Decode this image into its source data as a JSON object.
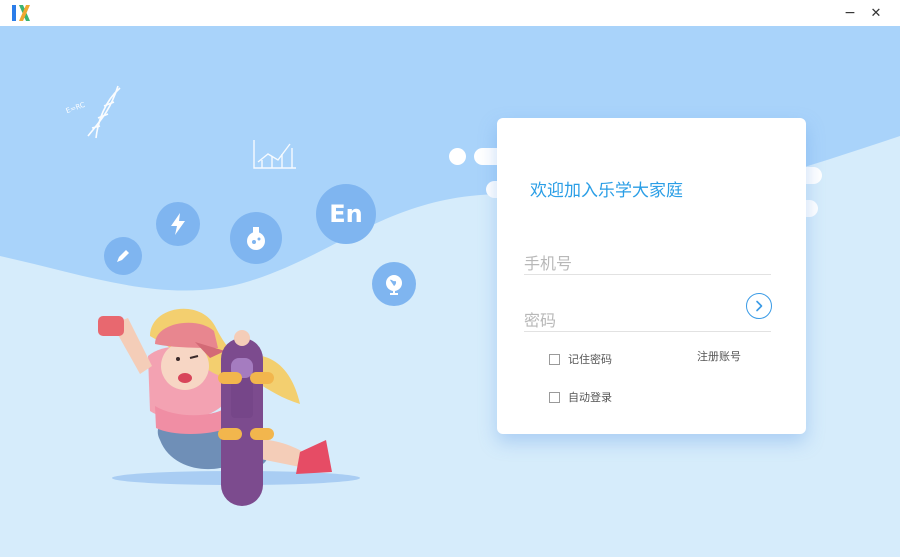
{
  "window": {
    "minimize_glyph": "−",
    "close_glyph": "✕"
  },
  "login": {
    "title": "欢迎加入乐学大家庭",
    "phone_placeholder": "手机号",
    "password_placeholder": "密码",
    "remember_label": "记住密码",
    "auto_login_label": "自动登录",
    "register_label": "注册账号"
  },
  "illustration": {
    "subject_en_label": "En",
    "formula_label": "E=RC"
  },
  "colors": {
    "accent": "#2a9ee6",
    "sky": "#a9d3fa",
    "ground": "#d6ecfb",
    "bubble": "#7fb5f0"
  }
}
